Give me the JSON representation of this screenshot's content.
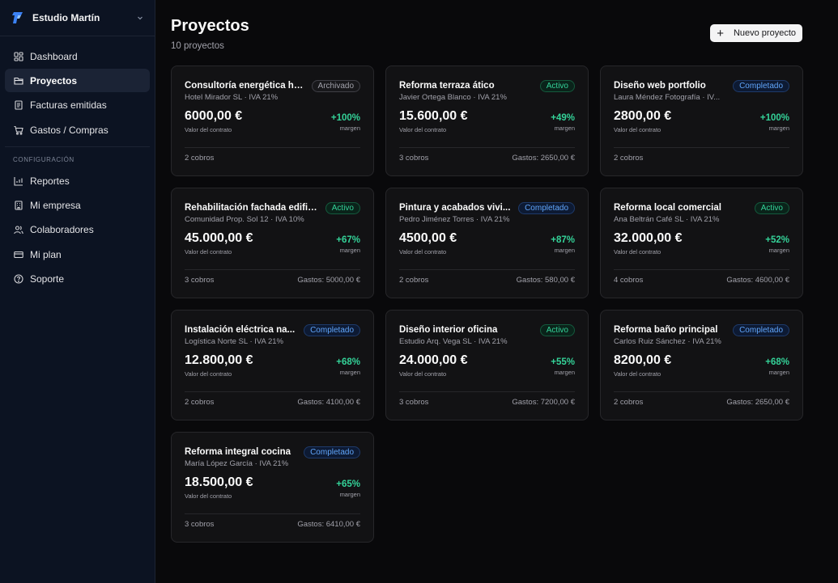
{
  "sidebar": {
    "brand": "Estudio Martín",
    "items": [
      {
        "label": "Dashboard",
        "icon": "grid-icon",
        "active": false
      },
      {
        "label": "Proyectos",
        "icon": "folder-icon",
        "active": true
      },
      {
        "label": "Facturas emitidas",
        "icon": "invoice-icon",
        "active": false
      },
      {
        "label": "Gastos / Compras",
        "icon": "cart-icon",
        "active": false
      }
    ],
    "section_label": "CONFIGURACIÓN",
    "config_items": [
      {
        "label": "Reportes",
        "icon": "chart-icon"
      },
      {
        "label": "Mi empresa",
        "icon": "building-icon"
      },
      {
        "label": "Colaboradores",
        "icon": "users-icon"
      },
      {
        "label": "Mi plan",
        "icon": "credit-card-icon"
      },
      {
        "label": "Soporte",
        "icon": "help-icon"
      }
    ]
  },
  "header": {
    "title": "Proyectos",
    "subtitle": "10 proyectos",
    "new_button": "Nuevo proyecto"
  },
  "labels": {
    "amount_caption": "Valor del contrato",
    "margin_caption": "margen"
  },
  "projects": [
    {
      "title": "Consultoría energética ho...",
      "status": "Archivado",
      "status_class": "b-archivado",
      "client": "Hotel Mirador SL · IVA 21%",
      "amount": "6000,00 €",
      "margin": "+100%",
      "cobros": "2 cobros",
      "gastos": ""
    },
    {
      "title": "Reforma terraza ático",
      "status": "Activo",
      "status_class": "b-activo",
      "client": "Javier Ortega Blanco · IVA 21%",
      "amount": "15.600,00 €",
      "margin": "+49%",
      "cobros": "3 cobros",
      "gastos": "Gastos: 2650,00 €"
    },
    {
      "title": "Diseño web portfolio",
      "status": "Completado",
      "status_class": "b-completado",
      "client": "Laura Méndez Fotografía · IV...",
      "amount": "2800,00 €",
      "margin": "+100%",
      "cobros": "2 cobros",
      "gastos": ""
    },
    {
      "title": "Rehabilitación fachada edific...",
      "status": "Activo",
      "status_class": "b-activo",
      "client": "Comunidad Prop. Sol 12 · IVA 10%",
      "amount": "45.000,00 €",
      "margin": "+67%",
      "cobros": "3 cobros",
      "gastos": "Gastos: 5000,00 €"
    },
    {
      "title": "Pintura y acabados vivi...",
      "status": "Completado",
      "status_class": "b-completado",
      "client": "Pedro Jiménez Torres · IVA 21%",
      "amount": "4500,00 €",
      "margin": "+87%",
      "cobros": "2 cobros",
      "gastos": "Gastos: 580,00 €"
    },
    {
      "title": "Reforma local comercial",
      "status": "Activo",
      "status_class": "b-activo",
      "client": "Ana Beltrán Café SL · IVA 21%",
      "amount": "32.000,00 €",
      "margin": "+52%",
      "cobros": "4 cobros",
      "gastos": "Gastos: 4600,00 €"
    },
    {
      "title": "Instalación eléctrica na...",
      "status": "Completado",
      "status_class": "b-completado",
      "client": "Logística Norte SL · IVA 21%",
      "amount": "12.800,00 €",
      "margin": "+68%",
      "cobros": "2 cobros",
      "gastos": "Gastos: 4100,00 €"
    },
    {
      "title": "Diseño interior oficina",
      "status": "Activo",
      "status_class": "b-activo",
      "client": "Estudio Arq. Vega SL · IVA 21%",
      "amount": "24.000,00 €",
      "margin": "+55%",
      "cobros": "3 cobros",
      "gastos": "Gastos: 7200,00 €"
    },
    {
      "title": "Reforma baño principal",
      "status": "Completado",
      "status_class": "b-completado",
      "client": "Carlos Ruiz Sánchez · IVA 21%",
      "amount": "8200,00 €",
      "margin": "+68%",
      "cobros": "2 cobros",
      "gastos": "Gastos: 2650,00 €"
    },
    {
      "title": "Reforma integral cocina",
      "status": "Completado",
      "status_class": "b-completado",
      "client": "María López García · IVA 21%",
      "amount": "18.500,00 €",
      "margin": "+65%",
      "cobros": "3 cobros",
      "gastos": "Gastos: 6410,00 €"
    }
  ]
}
